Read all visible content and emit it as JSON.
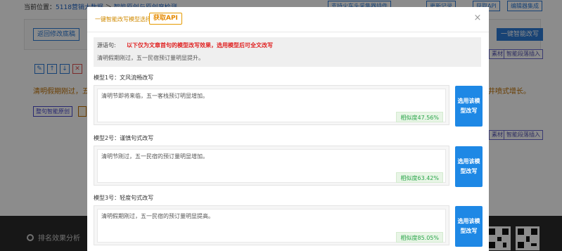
{
  "background": {
    "breadcrumb_prefix": "当前位置：",
    "breadcrumb_home": "5118营销大数据",
    "breadcrumb_sep": "＞",
    "breadcrumb_page": "智能原创与原创度检测",
    "top_buttons": [
      "支持火车头采集器插件",
      "更新记录",
      "获取API",
      "编辑器集成"
    ],
    "back_button": "返回修改底稿",
    "one_click_button": "一键智能改写",
    "small_buttons": [
      "素材",
      "智能段落插入"
    ],
    "tool_icons": [
      "✎",
      "↑",
      "↓",
      "✕"
    ],
    "text_left": "清明假期刚过，五",
    "text_right": "来井喷式增长。",
    "smart_button": "整句智能原创",
    "footer_rank": "排名效果分析"
  },
  "modal": {
    "title": "一键智能改写模型选择",
    "api_button": "获取API",
    "close_icon": "×",
    "source": {
      "label": "源语句:",
      "note": "以下仅为文章首句的模型改写效果，选用模型后可全文改写",
      "text": "清明假期刚过，五一民宿预订量明显提升。"
    },
    "models": [
      {
        "title": "模型1号：文风流畅改写",
        "text": "清明节即将来临，五一客栈预订明显增加。",
        "similarity": "相似度47.56%",
        "button": "选用该模型改写"
      },
      {
        "title": "模型2号：谨慎句式改写",
        "text": "清明节刚过，五一民宿的预订量明显增加。",
        "similarity": "相似度63.42%",
        "button": "选用该模型改写"
      },
      {
        "title": "模型3号：轻度句式改写",
        "text": "清明假期刚过，五一民宿的预订量明显提高。",
        "similarity": "相似度85.05%",
        "button": "选用该模型改写"
      }
    ]
  },
  "colors": {
    "primary": "#1e88e5",
    "warning": "#e58a00",
    "danger": "#e02424",
    "success": "#2aa64a"
  }
}
